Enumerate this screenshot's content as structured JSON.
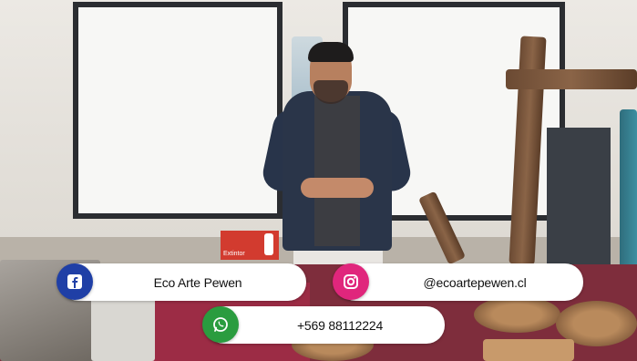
{
  "scene": {
    "sign_text": "Extintor"
  },
  "overlay": {
    "facebook": {
      "icon": "facebook-icon",
      "label": "Eco Arte Pewen",
      "color": "#1f3fa6"
    },
    "instagram": {
      "icon": "instagram-icon",
      "label": "@ecoartepewen.cl",
      "color": "#e0267c"
    },
    "whatsapp": {
      "icon": "whatsapp-icon",
      "label": "+569 88112224",
      "color": "#2a9c3f"
    }
  }
}
